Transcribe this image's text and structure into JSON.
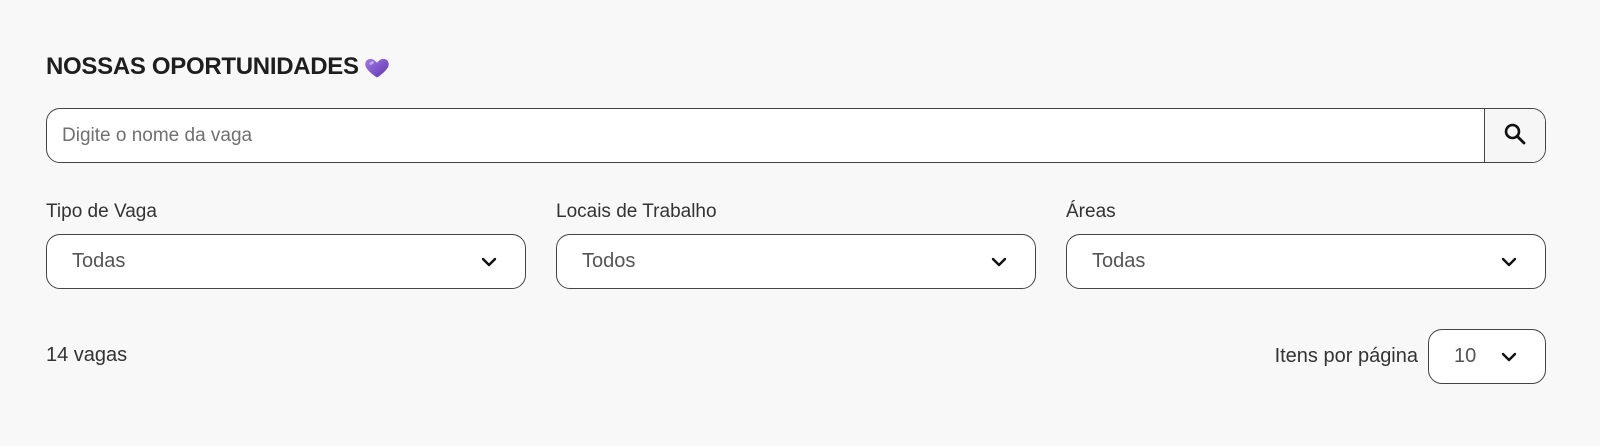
{
  "header": {
    "title": "NOSSAS OPORTUNIDADES",
    "title_icon": "purple-heart-icon",
    "heart_color": "#7b4fc9"
  },
  "search": {
    "placeholder": "Digite o nome da vaga",
    "value": "",
    "button_icon": "search-icon"
  },
  "filters": {
    "job_type": {
      "label": "Tipo de Vaga",
      "value": "Todas"
    },
    "locations": {
      "label": "Locais de Trabalho",
      "value": "Todos"
    },
    "areas": {
      "label": "Áreas",
      "value": "Todas"
    }
  },
  "results": {
    "count_text": "14 vagas"
  },
  "pagination": {
    "per_page_label": "Itens por página",
    "per_page_value": "10"
  }
}
